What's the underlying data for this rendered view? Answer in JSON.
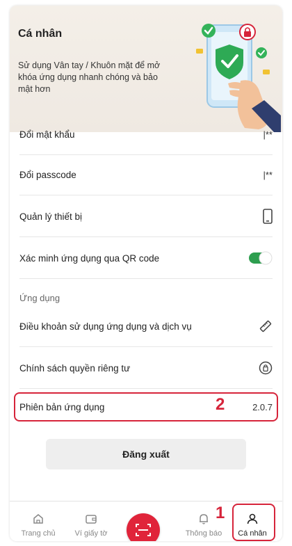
{
  "header": {
    "title": "Cá nhân",
    "description": "Sử dụng Vân tay / Khuôn mặt để mở khóa ứng dụng nhanh chóng và bảo mật hơn"
  },
  "settings": {
    "change_password": {
      "label": "Đổi mật khẩu",
      "value": "|**"
    },
    "change_passcode": {
      "label": "Đổi passcode",
      "value": "|**"
    },
    "device_management": {
      "label": "Quản lý thiết bị"
    },
    "qr_verify": {
      "label": "Xác minh ứng dụng qua QR code",
      "enabled": true
    }
  },
  "app_section": {
    "title": "Ứng dụng",
    "terms": {
      "label": "Điều khoản sử dụng ứng dụng và dịch vụ"
    },
    "privacy": {
      "label": "Chính sách quyền riêng tư"
    },
    "version": {
      "label": "Phiên bản ứng dụng",
      "value": "2.0.7"
    }
  },
  "logout": {
    "label": "Đăng xuất"
  },
  "annotations": {
    "marker_1": "1",
    "marker_2": "2"
  },
  "bottom_nav": {
    "home": "Trang chủ",
    "wallet": "Ví giấy tờ",
    "notifications": "Thông báo",
    "profile": "Cá nhân"
  },
  "colors": {
    "accent": "#e0243a",
    "toggle_on": "#2e9e4f",
    "highlight": "#d6243a"
  },
  "icons": [
    "device-icon",
    "ruler-icon",
    "shield-icon",
    "home-icon",
    "wallet-icon",
    "scan-icon",
    "bell-icon",
    "user-icon"
  ]
}
